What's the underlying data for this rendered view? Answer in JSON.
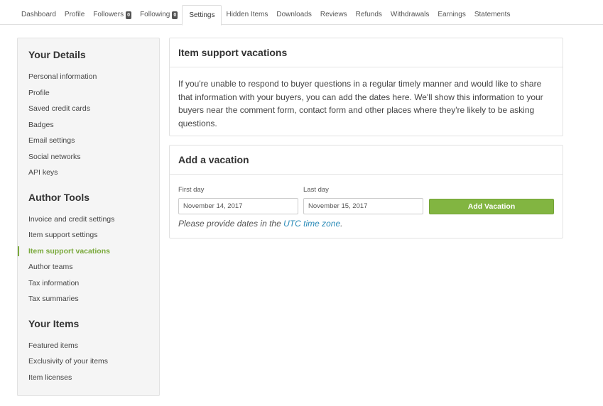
{
  "nav": {
    "items": [
      {
        "label": "Dashboard"
      },
      {
        "label": "Profile"
      },
      {
        "label": "Followers",
        "badge": "0"
      },
      {
        "label": "Following",
        "badge": "0"
      },
      {
        "label": "Settings"
      },
      {
        "label": "Hidden Items"
      },
      {
        "label": "Downloads"
      },
      {
        "label": "Reviews"
      },
      {
        "label": "Refunds"
      },
      {
        "label": "Withdrawals"
      },
      {
        "label": "Earnings"
      },
      {
        "label": "Statements"
      }
    ]
  },
  "sidebar": {
    "sections": [
      {
        "title": "Your Details",
        "items": [
          "Personal information",
          "Profile",
          "Saved credit cards",
          "Badges",
          "Email settings",
          "Social networks",
          "API keys"
        ]
      },
      {
        "title": "Author Tools",
        "items": [
          "Invoice and credit settings",
          "Item support settings",
          "Item support vacations",
          "Author teams",
          "Tax information",
          "Tax summaries"
        ]
      },
      {
        "title": "Your Items",
        "items": [
          "Featured items",
          "Exclusivity of your items",
          "Item licenses"
        ]
      }
    ],
    "active_item": "Item support vacations"
  },
  "info_panel": {
    "title": "Item support vacations",
    "body": "If you're unable to respond to buyer questions in a regular timely manner and would like to share that information with your buyers, you can add the dates here. We'll show this information to your buyers near the comment form, contact form and other places where they're likely to be asking questions."
  },
  "vacation_panel": {
    "title": "Add a vacation",
    "first_day_label": "First day",
    "first_day_value": "November 14, 2017",
    "last_day_label": "Last day",
    "last_day_value": "November 15, 2017",
    "button_label": "Add Vacation",
    "note_prefix": "Please provide dates in the",
    "note_link": "UTC time zone",
    "note_suffix": "."
  },
  "colors": {
    "accent_green": "#82b541",
    "active_green": "#7aa93c",
    "link_blue": "#2a8bb8"
  }
}
